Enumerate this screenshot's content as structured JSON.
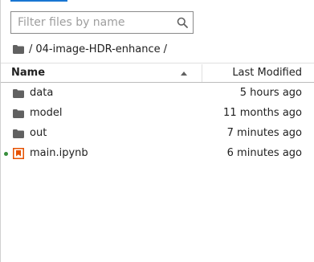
{
  "search": {
    "placeholder": "Filter files by name",
    "value": ""
  },
  "breadcrumb": {
    "separator_left": "/",
    "folder": "04-image-HDR-enhance",
    "separator_right": "/"
  },
  "table": {
    "columns": {
      "name": "Name",
      "last_modified": "Last Modified"
    },
    "sort": "name-ascending",
    "rows": [
      {
        "name": "data",
        "modified": "5 hours ago",
        "type": "folder",
        "running": false
      },
      {
        "name": "model",
        "modified": "11 months ago",
        "type": "folder",
        "running": false
      },
      {
        "name": "out",
        "modified": "7 minutes ago",
        "type": "folder",
        "running": false
      },
      {
        "name": "main.ipynb",
        "modified": "6 minutes ago",
        "type": "notebook",
        "running": true
      }
    ]
  },
  "colors": {
    "accent": "#1976d2",
    "notebook_icon": "#e65100",
    "running_dot": "#388e3c",
    "folder_icon": "#616161"
  },
  "icons": {
    "search": "search-icon",
    "folder": "folder-icon",
    "notebook": "notebook-icon",
    "sort": "caret-up-icon"
  }
}
